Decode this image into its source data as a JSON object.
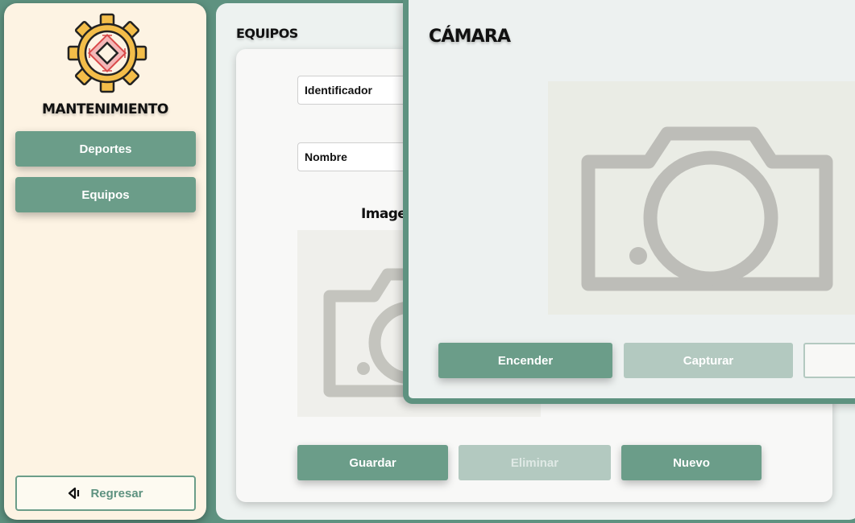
{
  "sidebar": {
    "brand": "MANTENIMIENTO",
    "items": [
      {
        "label": "Deportes"
      },
      {
        "label": "Equipos"
      }
    ],
    "back_label": "Regresar"
  },
  "form": {
    "section_title": "EQUIPOS",
    "fields": [
      {
        "placeholder": "Identificador"
      },
      {
        "placeholder": "Nombre"
      }
    ],
    "image_label": "Imagen",
    "buttons": {
      "save": "Guardar",
      "delete": "Eliminar",
      "new": "Nuevo"
    }
  },
  "camera_modal": {
    "title": "CÁMARA",
    "buttons": {
      "on": "Encender",
      "capture": "Capturar"
    }
  },
  "colors": {
    "accent": "#6b9d89",
    "background": "#5e9280",
    "sidebar_bg": "#fdf3e3",
    "disabled": "#b3c9c0"
  },
  "icons": [
    "gear-chip-logo-icon",
    "back-arrow-icon",
    "camera-placeholder-icon"
  ]
}
